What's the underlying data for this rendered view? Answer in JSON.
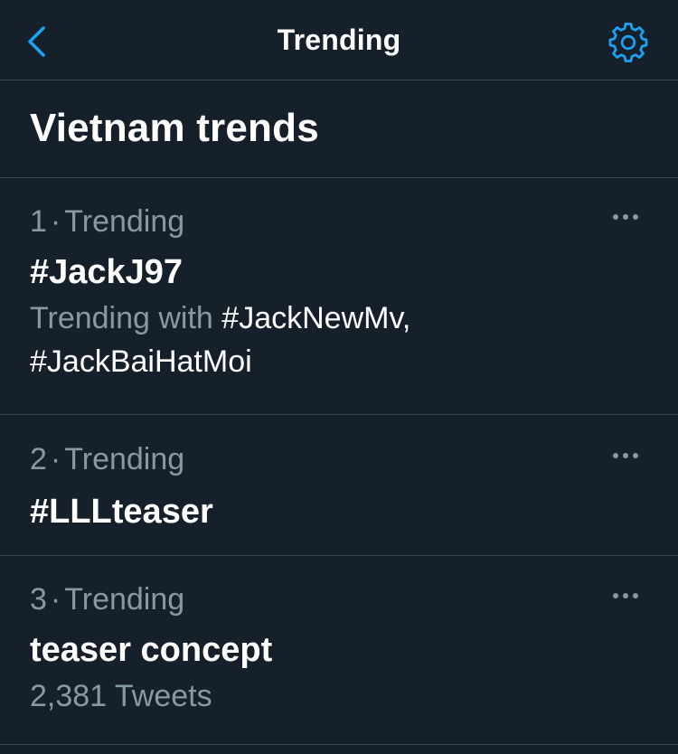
{
  "header": {
    "title": "Trending",
    "back_icon": "chevron-left-icon",
    "settings_icon": "gear-icon",
    "accent_color": "#1da1f2"
  },
  "section": {
    "title": "Vietnam trends"
  },
  "trends": [
    {
      "rank": "1",
      "sep": "·",
      "context": "Trending",
      "name": "#JackJ97",
      "sub_prefix": "Trending with ",
      "sub_tags_line1": "#JackNewMv,",
      "sub_tags_line2": "#JackBaiHatMoi"
    },
    {
      "rank": "2",
      "sep": "·",
      "context": "Trending",
      "name": "#LLLteaser"
    },
    {
      "rank": "3",
      "sep": "·",
      "context": "Trending",
      "name": "teaser concept",
      "tweets": "2,381 Tweets"
    }
  ],
  "colors": {
    "background": "#15202b",
    "divider": "#38444d",
    "secondary_text": "#8899a6",
    "primary_text": "#ffffff"
  }
}
